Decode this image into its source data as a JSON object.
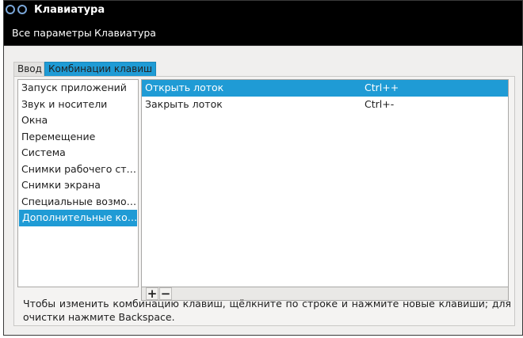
{
  "window": {
    "title": "Клавиатура"
  },
  "toolbar": {
    "breadcrumbs": [
      "Все параметры",
      "Клавиатура"
    ]
  },
  "tabs": [
    {
      "label": "Ввод",
      "selected": false
    },
    {
      "label": "Комбинации клавиш",
      "selected": true
    }
  ],
  "categories": [
    {
      "label": "Запуск приложений",
      "selected": false
    },
    {
      "label": "Звук и носители",
      "selected": false
    },
    {
      "label": "Окна",
      "selected": false
    },
    {
      "label": "Перемещение",
      "selected": false
    },
    {
      "label": "Система",
      "selected": false
    },
    {
      "label": "Снимки рабочего ст…",
      "selected": false
    },
    {
      "label": "Снимки экрана",
      "selected": false
    },
    {
      "label": "Специальные возмо…",
      "selected": false
    },
    {
      "label": "Дополнительные ко…",
      "selected": true
    }
  ],
  "shortcuts": [
    {
      "name": "Открыть лоток",
      "accel": "Ctrl++",
      "selected": true
    },
    {
      "name": "Закрыть лоток",
      "accel": "Ctrl+-",
      "selected": false
    }
  ],
  "shortcut_toolbar": {
    "add_label": "+",
    "remove_label": "−"
  },
  "hint": "Чтобы изменить комбинацию клавиш, щёлкните по строке и нажмите новые клавиши; для очистки нажмите Backspace.",
  "colors": {
    "selection": "#1f9bd5",
    "titlebar": "#000000"
  }
}
